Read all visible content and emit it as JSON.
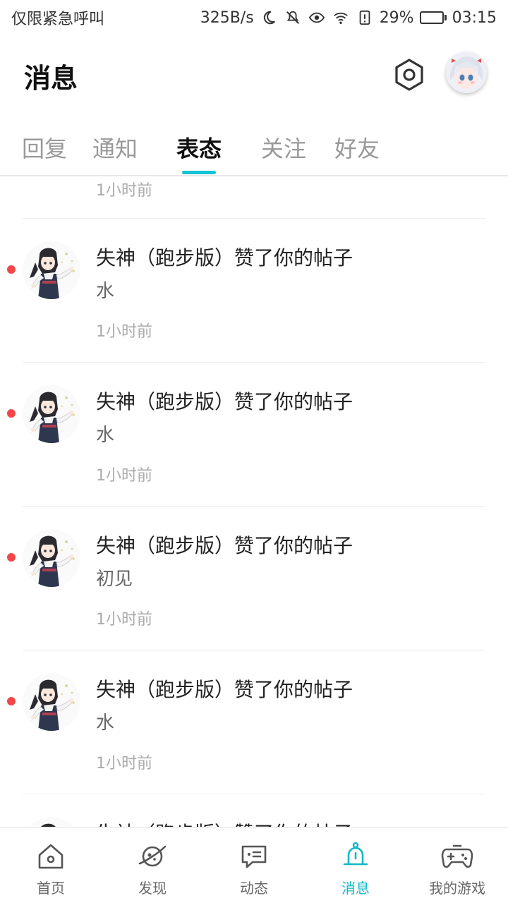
{
  "status_bar": {
    "carrier": "仅限紧急呼叫",
    "speed": "325B/s",
    "battery": "29%",
    "battery_level": 0.29,
    "time": "03:15",
    "icons": [
      "moon-icon",
      "mute-icon",
      "eye-icon",
      "wifi-icon",
      "sim-alert-icon",
      "battery-icon"
    ]
  },
  "header": {
    "title": "消息",
    "settings_icon": "hexagon-settings-icon"
  },
  "tabs": [
    {
      "label": "回复",
      "active": false
    },
    {
      "label": "通知",
      "active": false
    },
    {
      "label": "表态",
      "active": true
    },
    {
      "label": "关注",
      "active": false
    },
    {
      "label": "好友",
      "active": false
    }
  ],
  "list": {
    "partial_top_time": "1小时前",
    "items": [
      {
        "title": "失神（跑步版）赞了你的帖子",
        "content": "水",
        "time": "1小时前",
        "unread": true
      },
      {
        "title": "失神（跑步版）赞了你的帖子",
        "content": "水",
        "time": "1小时前",
        "unread": true
      },
      {
        "title": "失神（跑步版）赞了你的帖子",
        "content": "初见",
        "time": "1小时前",
        "unread": true
      },
      {
        "title": "失神（跑步版）赞了你的帖子",
        "content": "水",
        "time": "1小时前",
        "unread": true
      },
      {
        "title": "失神（跑步版）赞了你的帖子",
        "content": "",
        "time": "",
        "unread": false
      }
    ]
  },
  "bottom_nav": [
    {
      "label": "首页",
      "icon": "home-icon",
      "active": false
    },
    {
      "label": "发现",
      "icon": "planet-icon",
      "active": false
    },
    {
      "label": "动态",
      "icon": "chat-icon",
      "active": false
    },
    {
      "label": "消息",
      "icon": "bell-icon",
      "active": true
    },
    {
      "label": "我的游戏",
      "icon": "gamepad-icon",
      "active": false
    }
  ],
  "colors": {
    "accent": "#14c4d4",
    "unread_dot": "#f04848",
    "battery_fill": "#2ecc40"
  }
}
